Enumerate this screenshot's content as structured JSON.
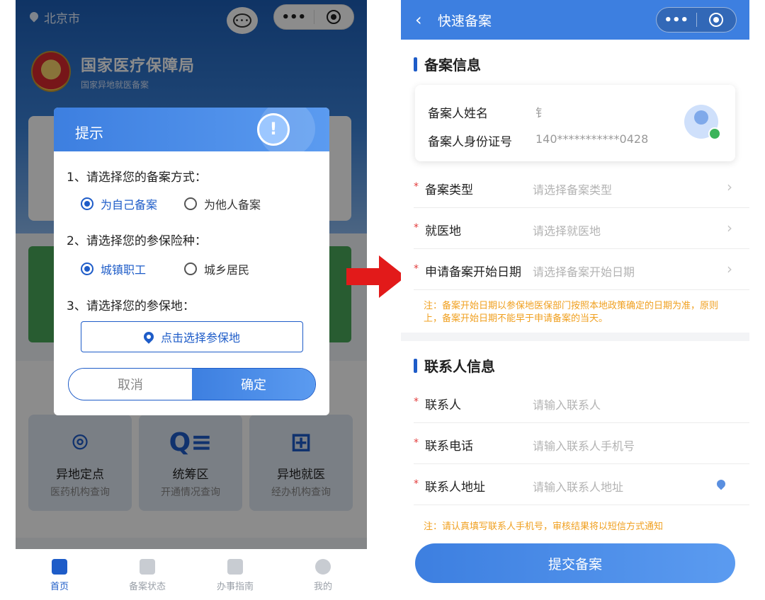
{
  "left": {
    "location": "北京市",
    "brand": {
      "name": "国家医疗保障局",
      "sub": "国家异地就医备案"
    },
    "dialog": {
      "title": "提示",
      "q1": "1、请选择您的备案方式：",
      "q1_options": [
        "为自己备案",
        "为他人备案"
      ],
      "q1_selected": "为自己备案",
      "q2": "2、请选择您的参保险种：",
      "q2_options": [
        "城镇职工",
        "城乡居民"
      ],
      "q2_selected": "城镇职工",
      "q3": "3、请选择您的参保地：",
      "pick_location": "点击选择参保地",
      "cancel": "取消",
      "confirm": "确定"
    },
    "services": [
      {
        "title": "异地定点",
        "sub": "医药机构查询",
        "icon": "location-pin-icon"
      },
      {
        "title": "统筹区",
        "sub": "开通情况查询",
        "icon": "search-list-icon"
      },
      {
        "title": "异地就医",
        "sub": "经办机构查询",
        "icon": "medical-kit-icon"
      }
    ],
    "tabs": [
      {
        "label": "首页",
        "active": true
      },
      {
        "label": "备案状态",
        "active": false
      },
      {
        "label": "办事指南",
        "active": false
      },
      {
        "label": "我的",
        "active": false
      }
    ]
  },
  "right": {
    "header_title": "快速备案",
    "section1": "备案信息",
    "info": {
      "name_label": "备案人姓名",
      "name_value": "钅",
      "id_label": "备案人身份证号",
      "id_value": "140***********0428"
    },
    "fields1": [
      {
        "label": "备案类型",
        "placeholder": "请选择备案类型"
      },
      {
        "label": "就医地",
        "placeholder": "请选择就医地"
      },
      {
        "label": "申请备案开始日期",
        "placeholder": "请选择备案开始日期"
      }
    ],
    "note1": "注：备案开始日期以参保地医保部门按照本地政策确定的日期为准，原则上，备案开始日期不能早于申请备案的当天。",
    "section2": "联系人信息",
    "fields2": [
      {
        "label": "联系人",
        "placeholder": "请输入联系人"
      },
      {
        "label": "联系电话",
        "placeholder": "请输入联系人手机号"
      },
      {
        "label": "联系人地址",
        "placeholder": "请输入联系人地址"
      }
    ],
    "note2": "注：请认真填写联系人手机号，审核结果将以短信方式通知",
    "submit": "提交备案"
  },
  "colors": {
    "primary": "#3d7fe0",
    "accent_blue": "#1e5cc8",
    "arrow_red": "#e21a1a",
    "note_orange": "#f0a020"
  }
}
